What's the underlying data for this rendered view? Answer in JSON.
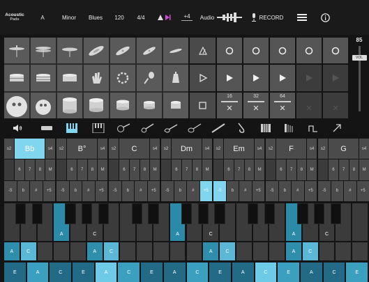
{
  "topbar": {
    "logo_line1": "Acoustic",
    "logo_line2": "Pads",
    "key": "A",
    "mode": "Minor",
    "style": "Blues",
    "tempo": "120",
    "time_signature": "4/4",
    "transpose": "+4",
    "audio_label": "Audio",
    "record_label": "RECORD"
  },
  "loops": {
    "col1_value": "16",
    "col2_value": "32",
    "col3_value": "64"
  },
  "volume": {
    "value": "85",
    "label": "VOL",
    "level_fraction": 0.85
  },
  "chords": [
    {
      "name": "Bb",
      "hl_main": true
    },
    {
      "name": "B°",
      "hl_main": false
    },
    {
      "name": "C",
      "hl_main": false
    },
    {
      "name": "Dm",
      "hl_main": false
    },
    {
      "name": "Em",
      "hl_main": false
    },
    {
      "name": "F",
      "hl_main": false
    },
    {
      "name": "G",
      "hl_main": false
    }
  ],
  "chord_labels": {
    "top_left": "s2",
    "top_right": "s4",
    "nums": [
      "6",
      "7",
      "8",
      "M"
    ],
    "mods": [
      "-5",
      "b",
      "#",
      "+5"
    ]
  },
  "keyboard_labels": [
    "A",
    "C",
    "A",
    "C",
    "A",
    "C",
    "A",
    "C"
  ],
  "noterow1_labels": [
    "A",
    "C",
    "A",
    "C",
    "A",
    "C",
    "A",
    "C"
  ],
  "noterow2_labels": [
    "E",
    "A",
    "C",
    "E",
    "A",
    "C",
    "E",
    "A",
    "C",
    "E",
    "A",
    "C",
    "E",
    "A",
    "C",
    "E"
  ],
  "colors": {
    "accent": "#2f8eac",
    "highlight": "#7fd6ee"
  }
}
